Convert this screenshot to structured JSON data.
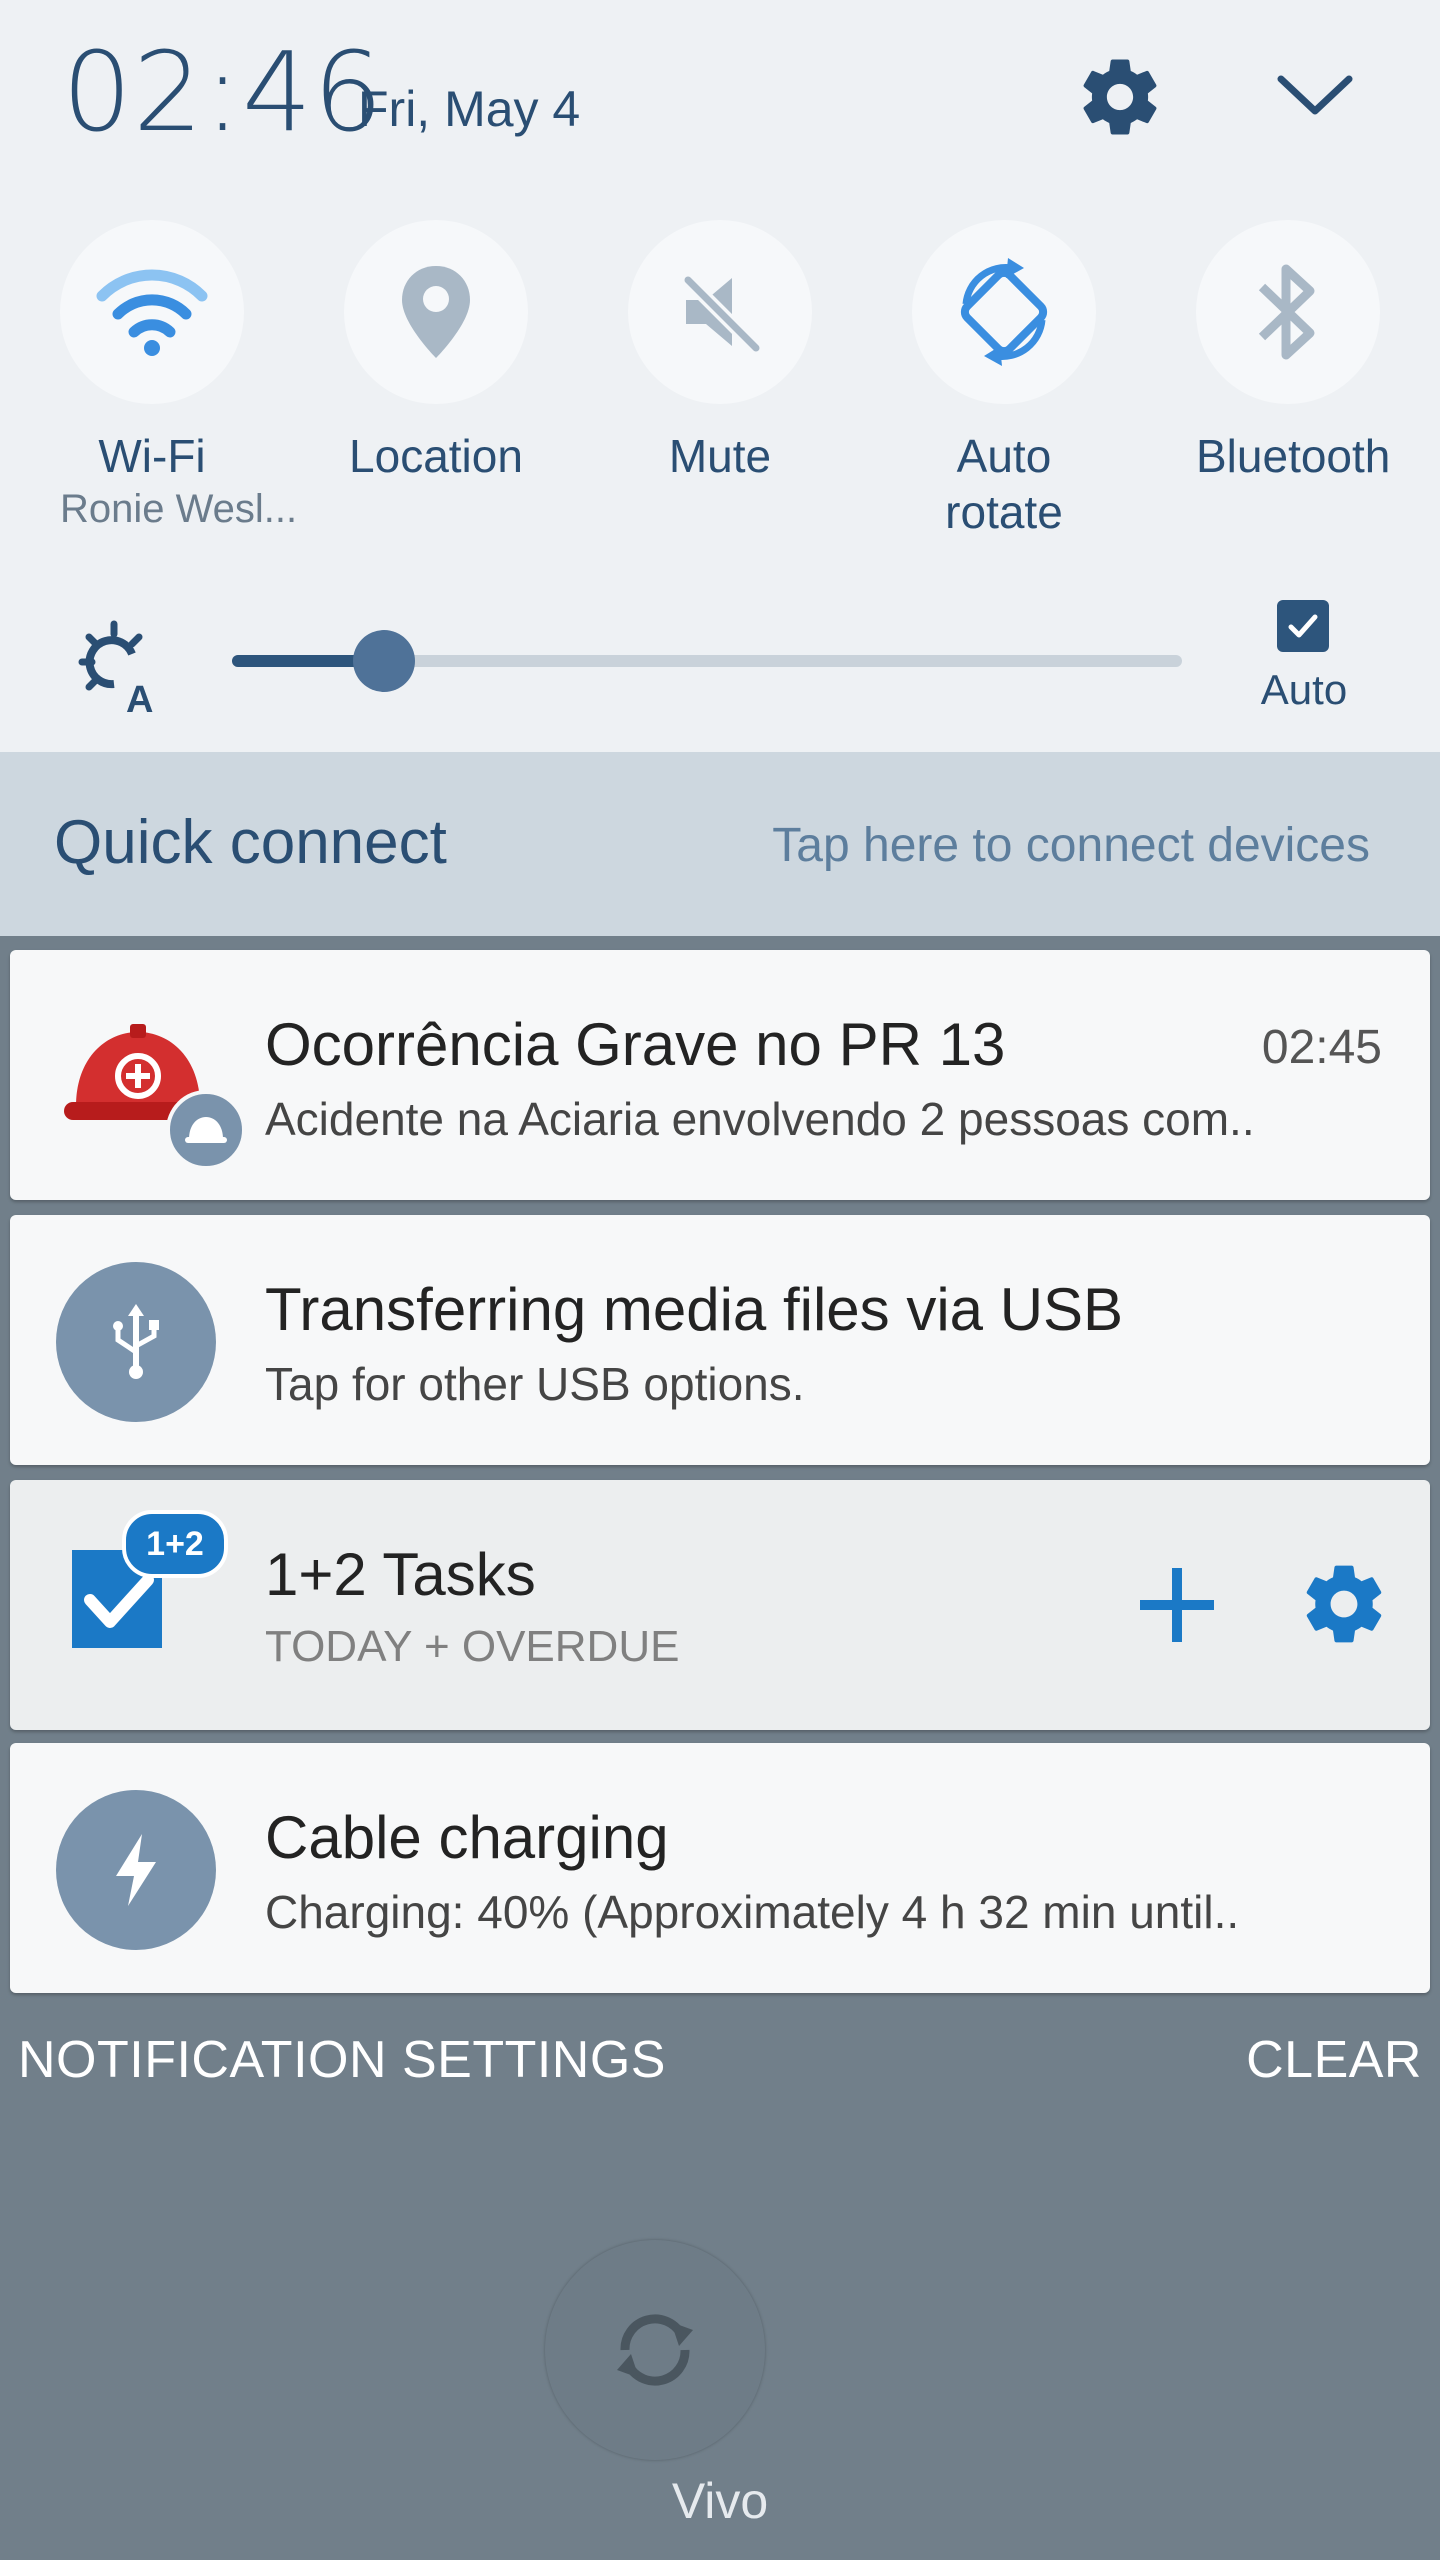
{
  "status": {
    "time": "02:46",
    "date": "Fri, May 4"
  },
  "quick_settings": [
    {
      "label": "Wi-Fi",
      "sub": "Ronie Wesl...",
      "icon": "wifi-icon",
      "active": true
    },
    {
      "label": "Location",
      "sub": "",
      "icon": "location-icon",
      "active": false
    },
    {
      "label": "Mute",
      "sub": "",
      "icon": "mute-icon",
      "active": false
    },
    {
      "label": "Auto\nrotate",
      "sub": "",
      "icon": "auto-rotate-icon",
      "active": true
    },
    {
      "label": "Bluetooth",
      "sub": "",
      "icon": "bluetooth-icon",
      "active": false
    }
  ],
  "brightness": {
    "level": 0.16,
    "auto_label": "Auto",
    "auto_checked": true
  },
  "quick_connect": {
    "title": "Quick connect",
    "hint": "Tap here to connect devices"
  },
  "notifications": [
    {
      "title": "Ocorrência Grave no PR 13",
      "text": "Acidente na Aciaria envolvendo 2 pessoas com..",
      "time": "02:45",
      "icon": "hard-hat-icon"
    },
    {
      "title": "Transferring media files via USB",
      "text": "Tap for other USB options.",
      "icon": "usb-icon"
    },
    {
      "title": "1+2 Tasks",
      "text": "TODAY + OVERDUE",
      "badge": "1+2",
      "icon": "task-check-icon"
    },
    {
      "title": "Cable charging",
      "text": "Charging: 40% (Approximately 4 h 32 min until..",
      "icon": "lightning-icon"
    }
  ],
  "footer": {
    "settings_label": "NOTIFICATION SETTINGS",
    "clear_label": "CLEAR"
  },
  "carrier": {
    "label": "Vivo"
  },
  "colors": {
    "accent": "#2a4e73",
    "active_icon": "#3a8ee0",
    "inactive_icon": "#a9b8c6",
    "notif_icon_bg": "#7a93ac",
    "task_blue": "#1b79c6"
  }
}
